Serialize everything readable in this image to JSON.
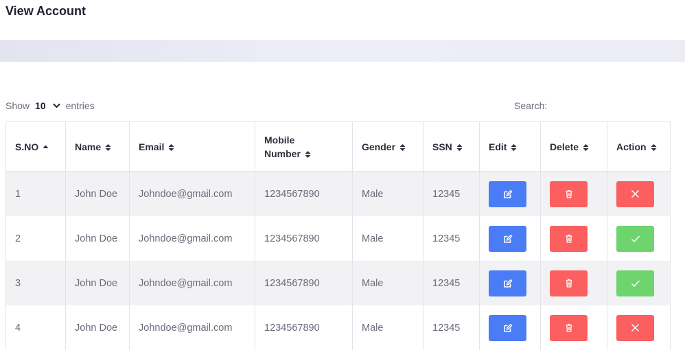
{
  "page": {
    "title": "View Account"
  },
  "controls": {
    "show_label": "Show",
    "entries_value": "10",
    "entries_label": "entries",
    "search_label": "Search:"
  },
  "table": {
    "columns": [
      "S.NO",
      "Name",
      "Email",
      "Mobile Number",
      "Gender",
      "SSN",
      "Edit",
      "Delete",
      "Action"
    ],
    "mobile_header": [
      "Mobile",
      "Number"
    ],
    "sorted_column": "S.NO",
    "rows": [
      {
        "sno": "1",
        "name": "John Doe",
        "email": "Johndoe@gmail.com",
        "mobile": "1234567890",
        "gender": "Male",
        "ssn": "12345",
        "action": "reject"
      },
      {
        "sno": "2",
        "name": "John Doe",
        "email": "Johndoe@gmail.com",
        "mobile": "1234567890",
        "gender": "Male",
        "ssn": "12345",
        "action": "approve"
      },
      {
        "sno": "3",
        "name": "John Doe",
        "email": "Johndoe@gmail.com",
        "mobile": "1234567890",
        "gender": "Male",
        "ssn": "12345",
        "action": "approve"
      },
      {
        "sno": "4",
        "name": "John Doe",
        "email": "Johndoe@gmail.com",
        "mobile": "1234567890",
        "gender": "Male",
        "ssn": "12345",
        "action": "reject"
      }
    ]
  },
  "icons": {
    "edit": "edit-icon",
    "delete": "trash-icon",
    "reject": "close-icon",
    "approve": "check-icon",
    "sort": "sort-icon"
  },
  "colors": {
    "edit_button": "#4a7cf6",
    "delete_button": "#fb5f5f",
    "reject_button": "#fb5f5f",
    "approve_button": "#6ed46e",
    "row_stripe": "#f2f2f4"
  }
}
